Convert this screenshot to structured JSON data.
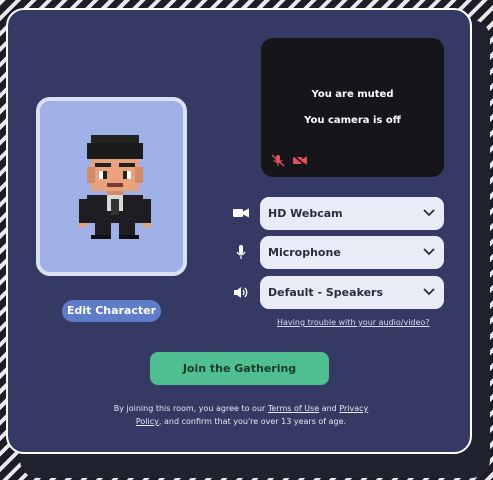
{
  "avatar": {
    "edit_label": "Edit Character"
  },
  "video": {
    "muted_text": "You are muted",
    "camera_text": "You camera is off",
    "icons": [
      "mic-muted-icon",
      "camera-off-icon"
    ],
    "icon_color": "#e0515f"
  },
  "devices": {
    "camera": {
      "icon": "video-camera-icon",
      "value": "HD Webcam"
    },
    "microphone": {
      "icon": "microphone-icon",
      "value": "Microphone"
    },
    "speaker": {
      "icon": "speaker-icon",
      "value": "Default - Speakers"
    }
  },
  "trouble_link": "Having trouble with your audio/video?",
  "join_label": "Join the Gathering",
  "legal": {
    "part1": "By joining this room, you agree to our ",
    "terms": "Terms of Use",
    "and": " and ",
    "privacy": "Privacy Policy",
    "part2": ", and confirm that you're over 13 years of age."
  },
  "colors": {
    "card_bg": "#343a64",
    "accent_green": "#4fbf8f",
    "edit_button": "#5f7cc8",
    "avatar_bg": "#9fb0e6"
  }
}
